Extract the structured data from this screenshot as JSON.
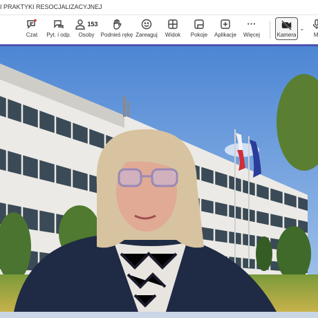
{
  "window": {
    "title": "I PRAKTYKI RESOCJALIZACYJNEJ"
  },
  "toolbar": {
    "items": [
      {
        "label": "Czat",
        "icon": "chat-icon",
        "badge_color": "#d13438"
      },
      {
        "label": "Pyt. i odp.",
        "icon": "qa-icon"
      },
      {
        "label": "Osoby",
        "icon": "people-icon",
        "count": "153"
      },
      {
        "label": "Podnieś rękę",
        "icon": "raise-hand-icon"
      },
      {
        "label": "Zareaguj",
        "icon": "smile-icon"
      },
      {
        "label": "Widok",
        "icon": "grid-icon"
      },
      {
        "label": "Pokoje",
        "icon": "rooms-icon"
      },
      {
        "label": "Aplikacje",
        "icon": "add-apps-icon"
      },
      {
        "label": "Więcej",
        "icon": "more-icon",
        "glyph": "···"
      }
    ],
    "camera": {
      "label": "Kamera",
      "icon": "camera-off-icon",
      "state": "off"
    },
    "cut_label": "Mi",
    "chevron": "⌄"
  },
  "colors": {
    "accent": "#4f52b2",
    "sky": "#5f95d8",
    "building": "#eceae6",
    "window": "#3a4a56",
    "tree": "#5f8a3f"
  }
}
